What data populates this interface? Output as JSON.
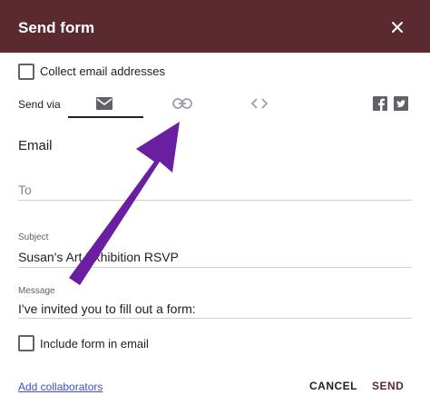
{
  "dialog": {
    "title": "Send form",
    "collect_email_label": "Collect email addresses",
    "send_via_label": "Send via",
    "section_title": "Email",
    "to_placeholder": "To",
    "subject_label": "Subject",
    "subject_value": "Susan's Art Exhibition RSVP",
    "message_label": "Message",
    "message_value": "I've invited you to fill out a form:",
    "include_form_label": "Include form in email",
    "add_collaborators_label": "Add collaborators",
    "cancel_label": "CANCEL",
    "send_label": "SEND"
  },
  "icons": {
    "close": "close-icon",
    "email_tab": "email-icon",
    "link_tab": "link-icon",
    "embed_tab": "embed-icon",
    "facebook": "facebook-icon",
    "twitter": "twitter-icon"
  },
  "colors": {
    "header_bg": "#5a2a30",
    "arrow": "#6a1fa0",
    "link": "#3c50c8",
    "button_text": "#5a2a30"
  }
}
